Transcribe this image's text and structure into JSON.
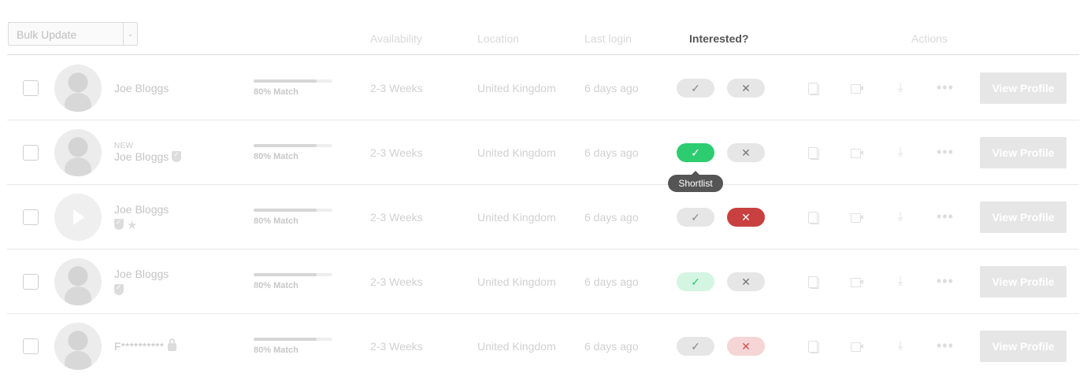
{
  "toolbar": {
    "bulk_update_label": "Bulk Update"
  },
  "columns": {
    "availability": "Availability",
    "location": "Location",
    "last_login": "Last login",
    "interested": "Interested?",
    "actions": "Actions"
  },
  "tooltip": {
    "shortlist": "Shortlist"
  },
  "rows": [
    {
      "badge": "",
      "name": "Joe Bloggs",
      "match_label": "80% Match",
      "match_pct": 80,
      "availability": "2-3 Weeks",
      "location": "United Kingdom",
      "last_login": "6 days ago",
      "yes_state": "default",
      "no_state": "default",
      "view_label": "View Profile",
      "icons": []
    },
    {
      "badge": "NEW",
      "name": "Joe Bloggs",
      "match_label": "80% Match",
      "match_pct": 80,
      "availability": "2-3 Weeks",
      "location": "United Kingdom",
      "last_login": "6 days ago",
      "yes_state": "active",
      "no_state": "default",
      "view_label": "View Profile",
      "icons": [
        "verified-shield-icon"
      ]
    },
    {
      "badge": "",
      "name": "Joe Bloggs",
      "match_label": "80% Match",
      "match_pct": 80,
      "availability": "2-3 Weeks",
      "location": "United Kingdom",
      "last_login": "6 days ago",
      "yes_state": "default",
      "no_state": "active",
      "view_label": "View Profile",
      "icons": [
        "verified-shield-icon",
        "star-icon"
      ]
    },
    {
      "badge": "",
      "name": "Joe Bloggs",
      "match_label": "80% Match",
      "match_pct": 80,
      "availability": "2-3 Weeks",
      "location": "United Kingdom",
      "last_login": "6 days ago",
      "yes_state": "soft",
      "no_state": "default",
      "view_label": "View Profile",
      "icons": [
        "verified-shield-icon"
      ]
    },
    {
      "badge": "",
      "name": "F**********",
      "match_label": "80% Match",
      "match_pct": 80,
      "availability": "2-3 Weeks",
      "location": "United Kingdom",
      "last_login": "6 days ago",
      "yes_state": "default",
      "no_state": "soft",
      "view_label": "View Profile",
      "icons": [
        "lock-icon"
      ]
    }
  ],
  "colors": {
    "accept_green": "#2ecc71",
    "reject_red": "#c94040",
    "tooltip_bg": "#555555"
  }
}
